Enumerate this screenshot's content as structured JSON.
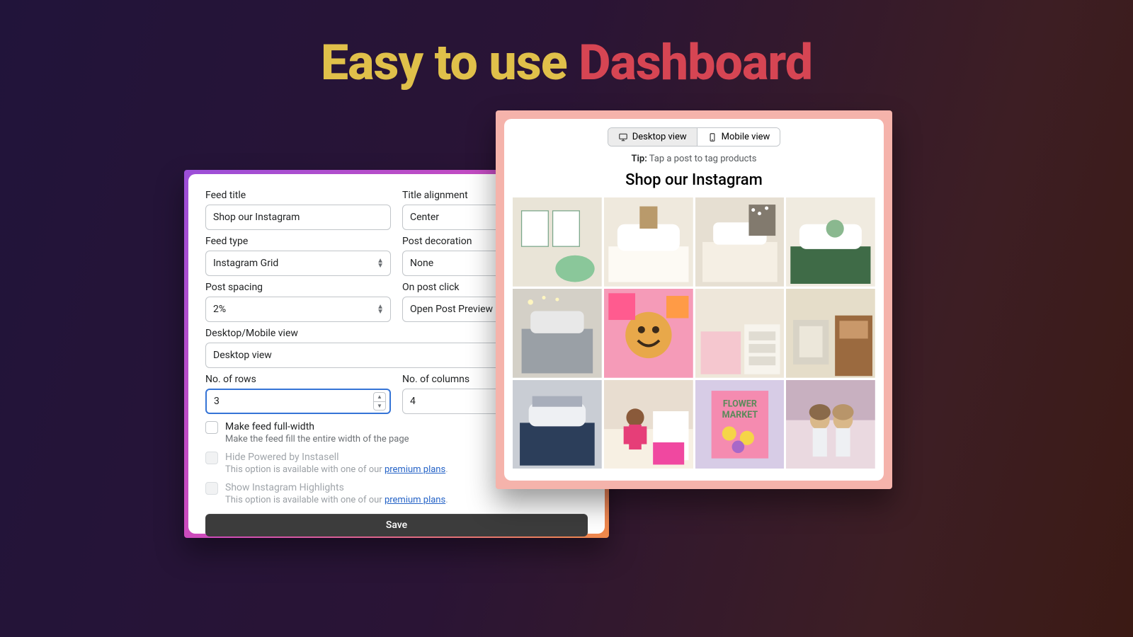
{
  "headline": {
    "part1": "Easy to use ",
    "part2": "Dashboard"
  },
  "settings": {
    "feed_title_label": "Feed title",
    "feed_title_value": "Shop our Instagram",
    "title_alignment_label": "Title alignment",
    "title_alignment_value": "Center",
    "feed_type_label": "Feed type",
    "feed_type_value": "Instagram Grid",
    "post_decoration_label": "Post decoration",
    "post_decoration_value": "None",
    "post_spacing_label": "Post spacing",
    "post_spacing_value": "2%",
    "on_post_click_label": "On post click",
    "on_post_click_value": "Open Post Preview",
    "desktop_mobile_view_label": "Desktop/Mobile view",
    "desktop_mobile_view_value": "Desktop view",
    "no_of_rows_label": "No. of rows",
    "no_of_rows_value": "3",
    "no_of_columns_label": "No. of columns",
    "no_of_columns_value": "4",
    "full_width_label": "Make feed full-width",
    "full_width_sub": "Make the feed fill the entire width of the page",
    "hide_powered_label": "Hide Powered by Instasell",
    "premium_sub_prefix": "This option is available with one of our ",
    "premium_link": "premium plans",
    "show_highlights_label": "Show Instagram Highlights",
    "save_label": "Save"
  },
  "preview": {
    "desktop_view_label": "Desktop view",
    "mobile_view_label": "Mobile view",
    "tip_label": "Tip:",
    "tip_text": "Tap a post to tag products",
    "title": "Shop our Instagram"
  }
}
